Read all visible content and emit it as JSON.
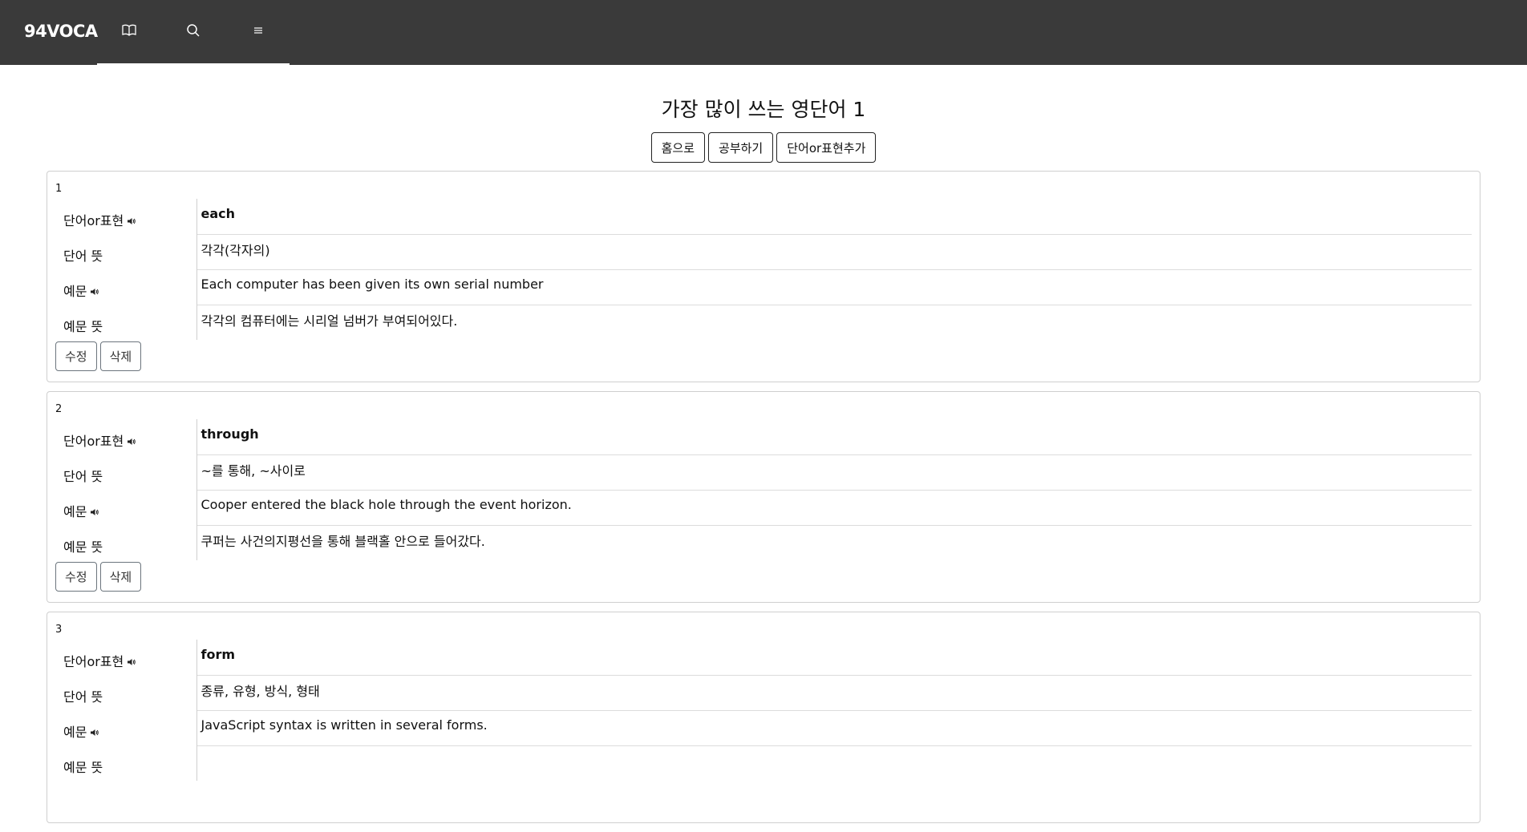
{
  "navbar": {
    "brand": "94VOCA",
    "icons": [
      "book-icon",
      "search-icon",
      "menu-icon"
    ],
    "bg_color": "#3a3a3a"
  },
  "page": {
    "title": "가장 많이 쓰는 영단어 1",
    "buttons": {
      "home": "홈으로",
      "study": "공부하기",
      "add": "단어or표현추가"
    }
  },
  "labels": {
    "word": "단어or표현",
    "meaning": "단어 뜻",
    "example": "예문",
    "example_meaning": "예문 뜻",
    "edit": "수정",
    "delete": "삭제"
  },
  "cards": [
    {
      "number": "1",
      "word": "each",
      "meaning": "각각(각자의)",
      "example": "Each computer has been given its own serial number",
      "example_meaning": "각각의 컴퓨터에는 시리얼 넘버가 부여되어있다."
    },
    {
      "number": "2",
      "word": "through",
      "meaning": "~를 통해, ~사이로",
      "example": "Cooper entered the black hole through the event horizon.",
      "example_meaning": "쿠퍼는 사건의지평선을 통해 블랙홀 안으로 들어갔다."
    },
    {
      "number": "3",
      "word": "form",
      "meaning": "종류, 유형, 방식, 형태",
      "example": "JavaScript syntax is written in several forms.",
      "example_meaning": ""
    }
  ]
}
